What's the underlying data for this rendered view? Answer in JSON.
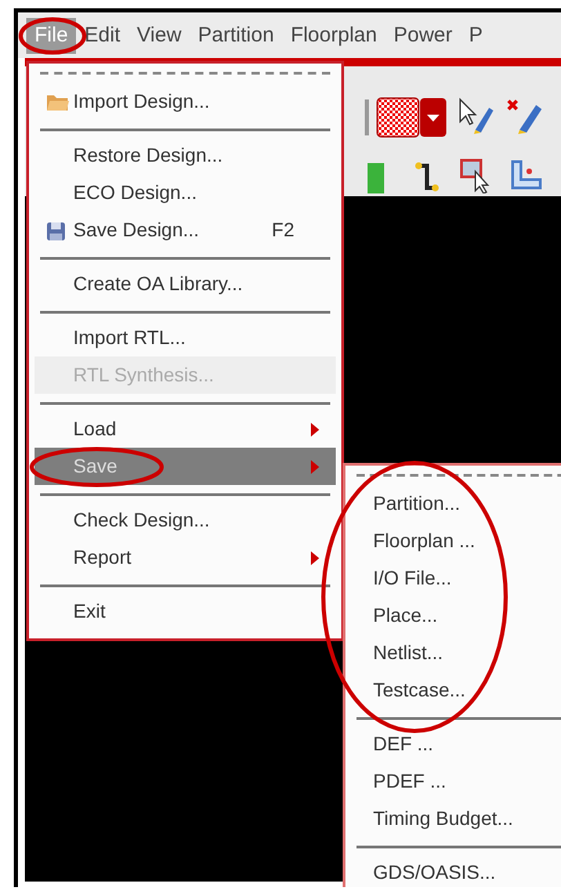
{
  "menubar": [
    {
      "label": "File",
      "selected": true
    },
    {
      "label": "Edit",
      "selected": false
    },
    {
      "label": "View",
      "selected": false
    },
    {
      "label": "Partition",
      "selected": false
    },
    {
      "label": "Floorplan",
      "selected": false
    },
    {
      "label": "Power",
      "selected": false
    },
    {
      "label": "P",
      "selected": false
    }
  ],
  "file_menu": [
    {
      "kind": "tearoff"
    },
    {
      "kind": "item",
      "label": "Import Design...",
      "disabled": false,
      "selected": false
    },
    {
      "kind": "separator"
    },
    {
      "kind": "item",
      "label": "Restore Design...",
      "disabled": false,
      "selected": false
    },
    {
      "kind": "item",
      "label": "ECO Design...",
      "disabled": false,
      "selected": false
    },
    {
      "kind": "item",
      "label": "Save Design...",
      "shortcut": "F2",
      "disabled": false,
      "selected": false
    },
    {
      "kind": "separator"
    },
    {
      "kind": "item",
      "label": "Create OA Library...",
      "disabled": false,
      "selected": false
    },
    {
      "kind": "separator"
    },
    {
      "kind": "item",
      "label": "Import RTL...",
      "disabled": false,
      "selected": false
    },
    {
      "kind": "item",
      "label": "RTL Synthesis...",
      "disabled": true,
      "selected": false
    },
    {
      "kind": "separator"
    },
    {
      "kind": "submenu",
      "label": "Load",
      "disabled": false,
      "selected": false
    },
    {
      "kind": "submenu",
      "label": "Save",
      "disabled": false,
      "selected": true
    },
    {
      "kind": "separator"
    },
    {
      "kind": "item",
      "label": "Check Design...",
      "disabled": false,
      "selected": false
    },
    {
      "kind": "submenu",
      "label": "Report",
      "disabled": false,
      "selected": false
    },
    {
      "kind": "separator"
    },
    {
      "kind": "item",
      "label": "Exit",
      "disabled": false,
      "selected": false
    }
  ],
  "save_submenu": [
    {
      "kind": "tearoff"
    },
    {
      "kind": "item",
      "label": "Partition...",
      "disabled": false,
      "selected": false
    },
    {
      "kind": "item",
      "label": "Floorplan ...",
      "disabled": false,
      "selected": false
    },
    {
      "kind": "item",
      "label": "I/O File...",
      "disabled": false,
      "selected": false
    },
    {
      "kind": "item",
      "label": "Place...",
      "disabled": false,
      "selected": false
    },
    {
      "kind": "item",
      "label": "Netlist...",
      "disabled": false,
      "selected": false
    },
    {
      "kind": "item",
      "label": "Testcase...",
      "disabled": false,
      "selected": false
    },
    {
      "kind": "separator"
    },
    {
      "kind": "item",
      "label": "DEF ...",
      "disabled": false,
      "selected": false
    },
    {
      "kind": "item",
      "label": "PDEF ...",
      "disabled": false,
      "selected": false
    },
    {
      "kind": "item",
      "label": "Timing Budget...",
      "disabled": false,
      "selected": false
    },
    {
      "kind": "separator"
    },
    {
      "kind": "item",
      "label": "GDS/OASIS...",
      "disabled": false,
      "selected": false
    }
  ]
}
